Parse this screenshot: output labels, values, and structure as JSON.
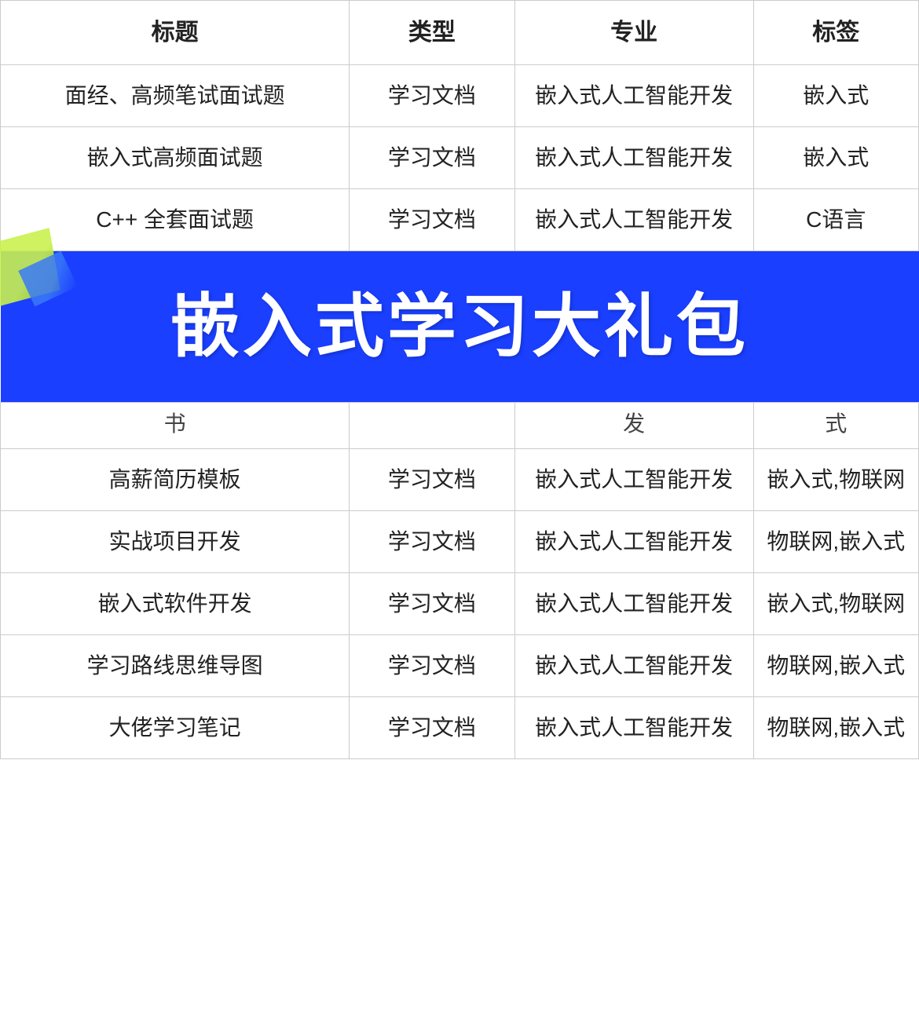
{
  "table": {
    "headers": [
      "标题",
      "类型",
      "专业",
      "标签"
    ],
    "rows": [
      {
        "title": "面经、高频笔试面试题",
        "type": "学习文档",
        "major": "嵌入式人工智能开发",
        "tag": "嵌入式"
      },
      {
        "title": "嵌入式高频面试题",
        "type": "学习文档",
        "major": "嵌入式人工智能开发",
        "tag": "嵌入式"
      },
      {
        "title": "C++ 全套面试题",
        "type": "学习文档",
        "major": "嵌入式人工智能开发",
        "tag": "C语言"
      }
    ],
    "partial_top": {
      "col3": "发",
      "col4": "式"
    },
    "banner_text": "嵌入式学习大礼包",
    "rows_after": [
      {
        "title": "高薪简历模板",
        "type": "学习文档",
        "major": "嵌入式人工智能开发",
        "tag": "嵌入式,物联网"
      },
      {
        "title": "实战项目开发",
        "type": "学习文档",
        "major": "嵌入式人工智能开发",
        "tag": "物联网,嵌入式"
      },
      {
        "title": "嵌入式软件开发",
        "type": "学习文档",
        "major": "嵌入式人工智能开发",
        "tag": "嵌入式,物联网"
      },
      {
        "title": "学习路线思维导图",
        "type": "学习文档",
        "major": "嵌入式人工智能开发",
        "tag": "物联网,嵌入式"
      },
      {
        "title": "大佬学习笔记",
        "type": "学习文档",
        "major": "嵌入式人工智能开发",
        "tag": "物联网,嵌入式"
      }
    ]
  }
}
